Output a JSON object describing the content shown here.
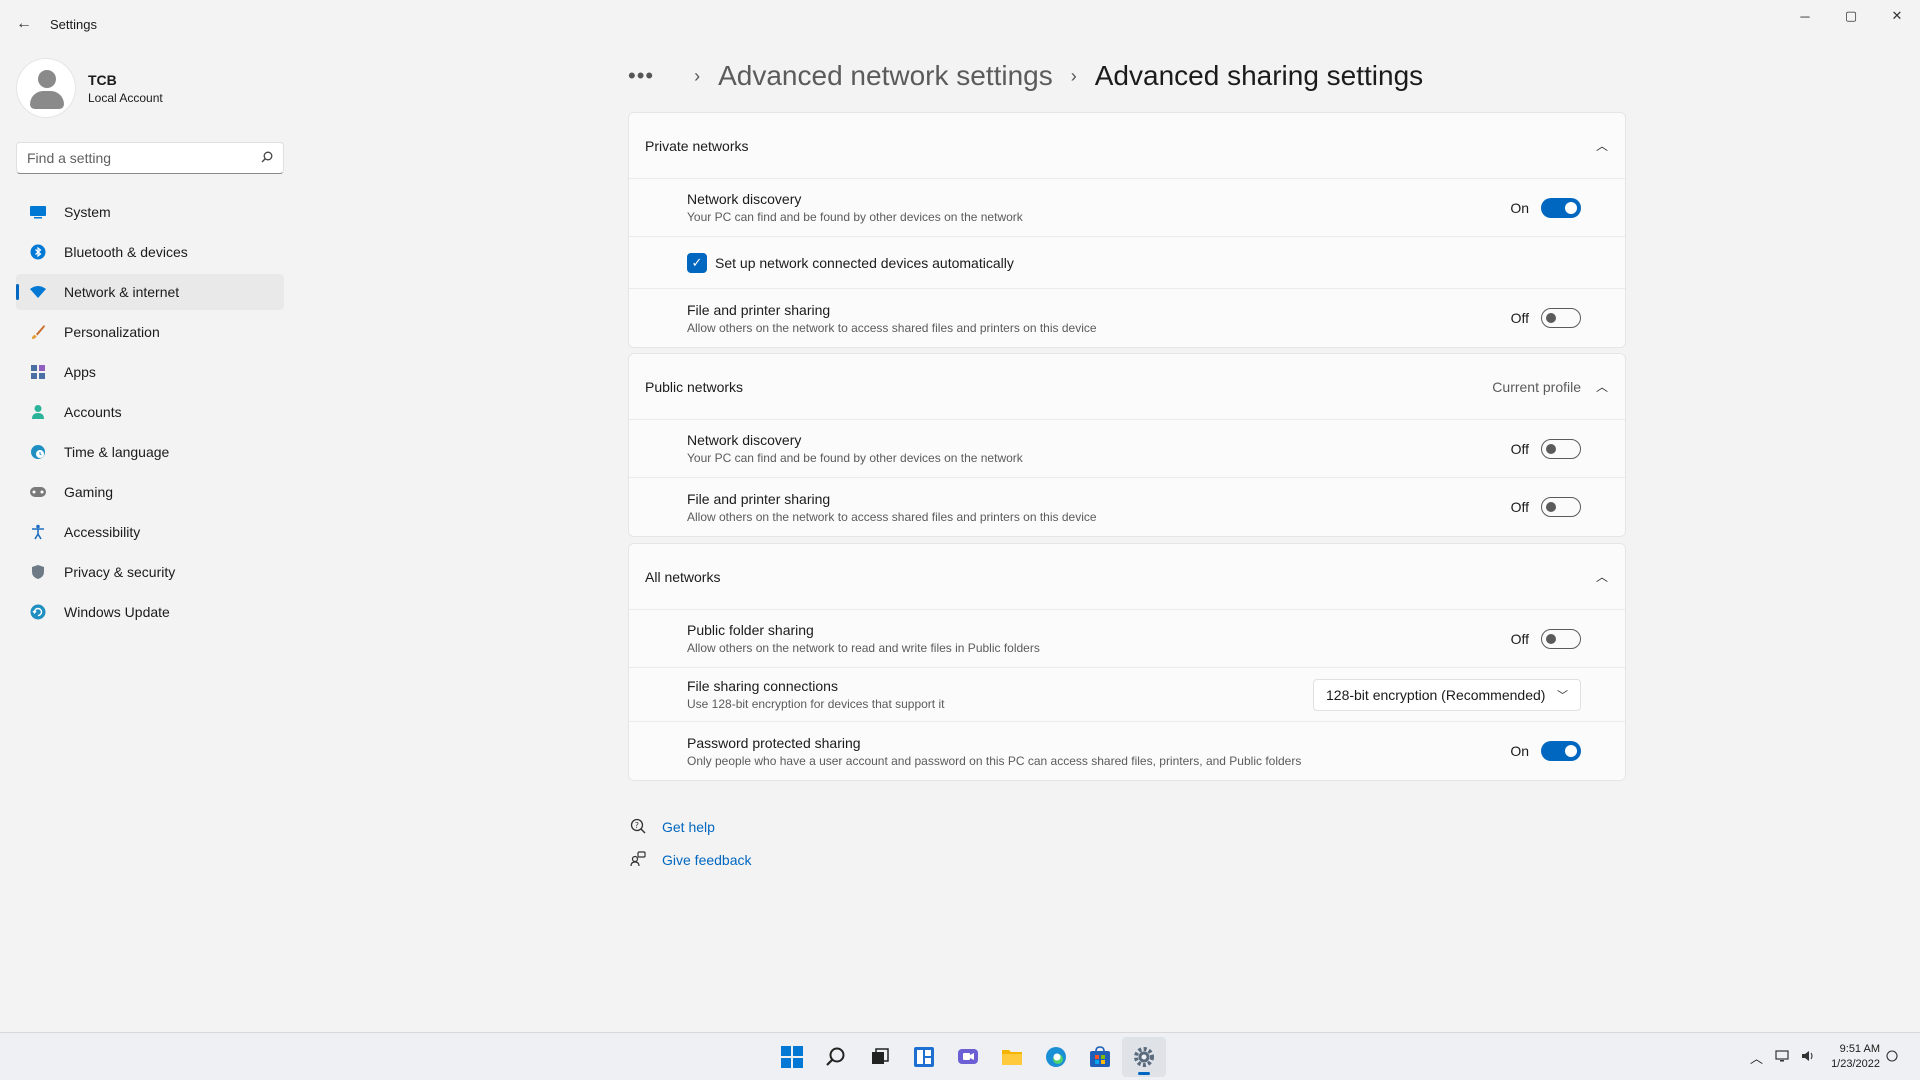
{
  "window": {
    "title": "Settings",
    "back_glyph": "←",
    "minimize_glyph": "─",
    "maximize_glyph": "▢",
    "close_glyph": "✕"
  },
  "profile": {
    "name": "TCB",
    "account_type": "Local Account"
  },
  "search": {
    "placeholder": "Find a setting"
  },
  "nav": {
    "items": [
      {
        "label": "System",
        "icon": "monitor-icon"
      },
      {
        "label": "Bluetooth & devices",
        "icon": "bluetooth-icon"
      },
      {
        "label": "Network & internet",
        "icon": "wifi-icon",
        "active": true
      },
      {
        "label": "Personalization",
        "icon": "brush-icon"
      },
      {
        "label": "Apps",
        "icon": "apps-icon"
      },
      {
        "label": "Accounts",
        "icon": "person-icon"
      },
      {
        "label": "Time & language",
        "icon": "globe-clock-icon"
      },
      {
        "label": "Gaming",
        "icon": "gamepad-icon"
      },
      {
        "label": "Accessibility",
        "icon": "accessibility-icon"
      },
      {
        "label": "Privacy & security",
        "icon": "shield-icon"
      },
      {
        "label": "Windows Update",
        "icon": "update-icon"
      }
    ]
  },
  "breadcrumb": {
    "overflow": "•••",
    "separator": "›",
    "parent": "Advanced network settings",
    "current": "Advanced sharing settings"
  },
  "sections": {
    "private": {
      "title": "Private networks",
      "network_discovery": {
        "title": "Network discovery",
        "desc": "Your PC can find and be found by other devices on the network",
        "state": "On"
      },
      "auto_setup": {
        "label": "Set up network connected devices automatically",
        "checked": true
      },
      "file_printer": {
        "title": "File and printer sharing",
        "desc": "Allow others on the network to access shared files and printers on this device",
        "state": "Off"
      }
    },
    "public": {
      "title": "Public networks",
      "meta": "Current profile",
      "network_discovery": {
        "title": "Network discovery",
        "desc": "Your PC can find and be found by other devices on the network",
        "state": "Off"
      },
      "file_printer": {
        "title": "File and printer sharing",
        "desc": "Allow others on the network to access shared files and printers on this device",
        "state": "Off"
      }
    },
    "all": {
      "title": "All networks",
      "public_folder": {
        "title": "Public folder sharing",
        "desc": "Allow others on the network to read and write files in Public folders",
        "state": "Off"
      },
      "file_sharing_connections": {
        "title": "File sharing connections",
        "desc": "Use 128-bit encryption for devices that support it",
        "selected": "128-bit encryption (Recommended)"
      },
      "password_protected": {
        "title": "Password protected sharing",
        "desc": "Only people who have a user account and password on this PC can access shared files, printers, and Public folders",
        "state": "On"
      }
    }
  },
  "help_links": {
    "get_help": "Get help",
    "give_feedback": "Give feedback"
  },
  "taskbar": {
    "time": "9:51 AM",
    "date": "1/23/2022",
    "accent": "#0067c0"
  }
}
